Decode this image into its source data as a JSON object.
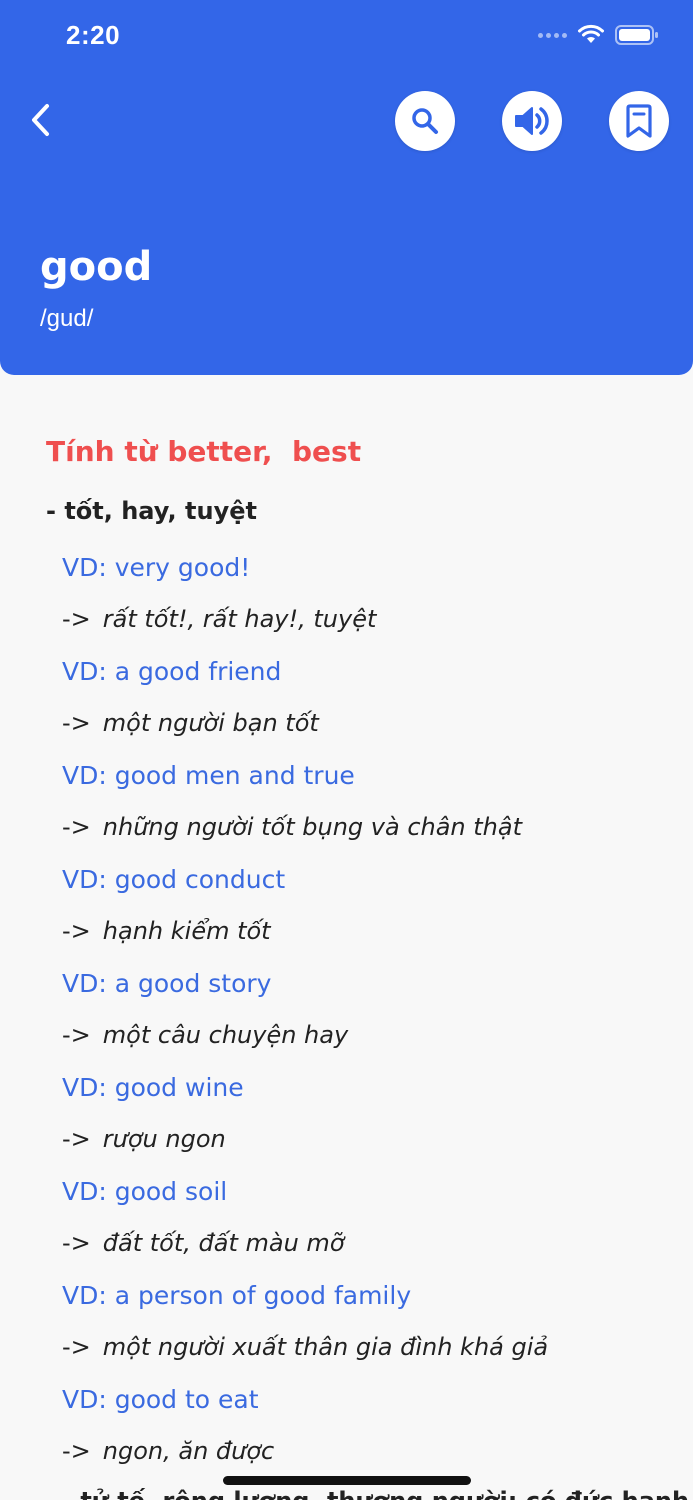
{
  "status_bar": {
    "time": "2:20"
  },
  "header": {
    "word": "good",
    "phonetic": "/gud/",
    "icons": {
      "back": "back-chevron-icon",
      "search": "search-icon",
      "speaker": "speaker-icon",
      "bookmark": "bookmark-icon"
    },
    "background_color": "#3366e8"
  },
  "entry": {
    "part_of_speech": "Tính từ better,  best",
    "meaning": "- tốt, hay, tuyệt",
    "examples": [
      {
        "example": "VD: very good!",
        "translation": "rất tốt!, rất hay!, tuyệt"
      },
      {
        "example": "VD: a good friend",
        "translation": "một người bạn tốt"
      },
      {
        "example": "VD: good men and true",
        "translation": "những người tốt bụng và chân thật"
      },
      {
        "example": "VD: good conduct",
        "translation": "hạnh kiểm tốt"
      },
      {
        "example": "VD: a good story",
        "translation": "một câu chuyện hay"
      },
      {
        "example": "VD: good wine",
        "translation": "rượu ngon"
      },
      {
        "example": "VD: good soil",
        "translation": "đất tốt, đất màu mỡ"
      },
      {
        "example": "VD: a person of good family",
        "translation": "một người xuất thân gia đình khá giả"
      },
      {
        "example": "VD: good to eat",
        "translation": "ngon, ăn được"
      }
    ],
    "arrow": "->",
    "next_meaning_partial": "- tử tế, rộng lượng, thương người; có đức hạnh",
    "colors": {
      "part_of_speech": "#ef4f4f",
      "example": "#3a6ae0",
      "text": "#222222"
    }
  }
}
